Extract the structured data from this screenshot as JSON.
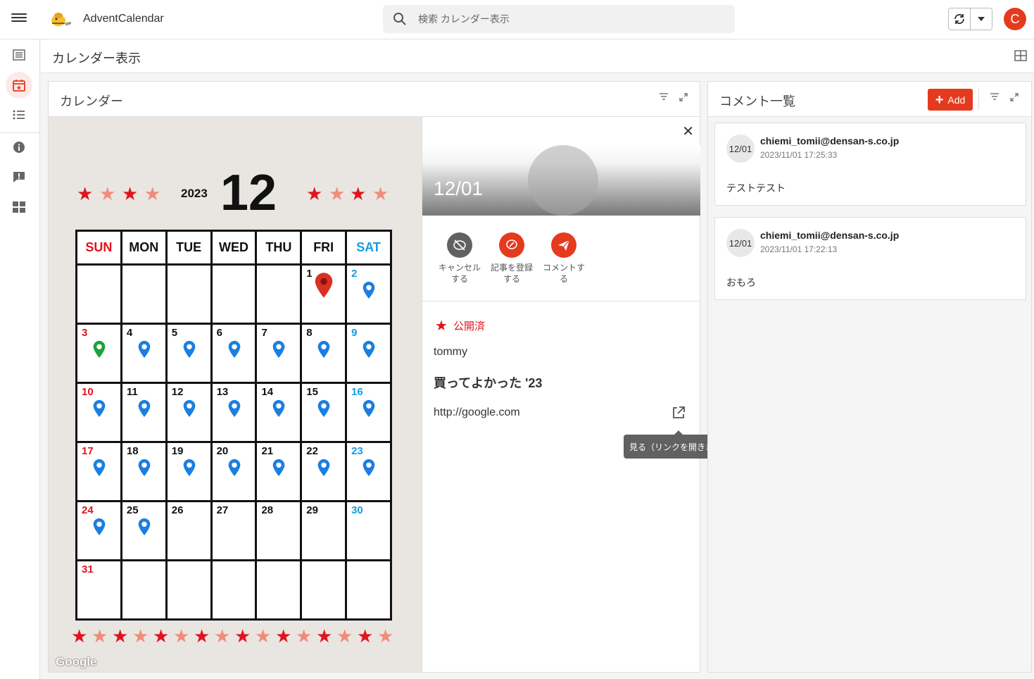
{
  "app": {
    "title": "AdventCalendar",
    "avatar_letter": "C",
    "accent": "#e53a1e"
  },
  "search": {
    "placeholder": "検索 カレンダー表示"
  },
  "page": {
    "title": "カレンダー表示"
  },
  "sidebar": {
    "items": [
      "list-icon",
      "calendar-icon",
      "bullet-list-icon",
      "info-icon",
      "feedback-icon",
      "dashboard-icon"
    ],
    "active": "calendar-icon"
  },
  "calendar_panel": {
    "title": "カレンダー",
    "year": "2023",
    "month": "12",
    "weekdays": [
      "SUN",
      "MON",
      "TUE",
      "WED",
      "THU",
      "FRI",
      "SAT"
    ],
    "weeks": [
      [
        "",
        "",
        "",
        "",
        "",
        "1",
        "2"
      ],
      [
        "3",
        "4",
        "5",
        "6",
        "7",
        "8",
        "9"
      ],
      [
        "10",
        "11",
        "12",
        "13",
        "14",
        "15",
        "16"
      ],
      [
        "17",
        "18",
        "19",
        "20",
        "21",
        "22",
        "23"
      ],
      [
        "24",
        "25",
        "26",
        "27",
        "28",
        "29",
        "30"
      ],
      [
        "31",
        "",
        "",
        "",
        "",
        "",
        ""
      ]
    ],
    "map_attribution": "Google"
  },
  "detail": {
    "date": "12/01",
    "actions": [
      {
        "label_line1": "キャンセル",
        "label_line2": "する"
      },
      {
        "label_line1": "記事を登録",
        "label_line2": "する"
      },
      {
        "label_line1": "コメントす",
        "label_line2": "る"
      }
    ],
    "status": "公開済",
    "author": "tommy",
    "article_title": "買ってよかった '23",
    "url": "http://google.com",
    "tooltip": "見る（リンクを開きます）"
  },
  "comments_panel": {
    "title": "コメント一覧",
    "add_label": "Add",
    "comments": [
      {
        "date": "12/01",
        "user": "chiemi_tomii@densan-s.co.jp",
        "time": "2023/11/01 17:25:33",
        "text": "テストテスト"
      },
      {
        "date": "12/01",
        "user": "chiemi_tomii@densan-s.co.jp",
        "time": "2023/11/01 17:22:13",
        "text": "おもろ"
      }
    ]
  }
}
